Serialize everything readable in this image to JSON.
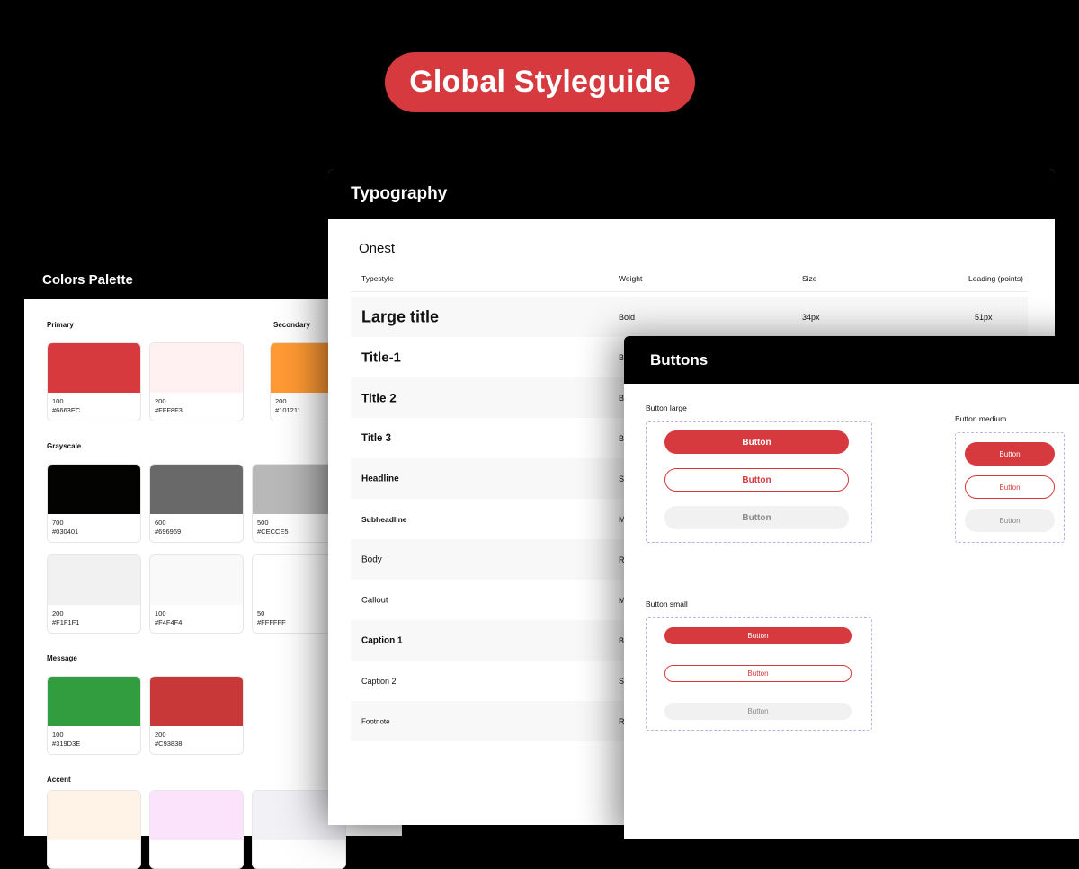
{
  "hero": {
    "title": "Global Styleguide"
  },
  "colors": {
    "title": "Colors Palette",
    "sections": [
      {
        "label": "Primary"
      },
      {
        "label": "Secondary"
      },
      {
        "label": "Grayscale"
      },
      {
        "label": "Message"
      },
      {
        "label": "Accent"
      }
    ],
    "swatches": [
      {
        "shade": "100",
        "hex": "#6663EC",
        "color": "#D63A3E"
      },
      {
        "shade": "200",
        "hex": "#FFF8F3",
        "color": "#FFF1F1"
      },
      {
        "shade": "200",
        "hex": "#101211",
        "color": "#FF9A33"
      },
      {
        "shade": "700",
        "hex": "#030401",
        "color": "#030401"
      },
      {
        "shade": "600",
        "hex": "#696969",
        "color": "#696969"
      },
      {
        "shade": "500",
        "hex": "#CECCE5",
        "color": "#B8B8B8"
      },
      {
        "shade": "200",
        "hex": "#F1F1F1",
        "color": "#F1F1F1"
      },
      {
        "shade": "100",
        "hex": "#F4F4F4",
        "color": "#F9F9F9"
      },
      {
        "shade": "50",
        "hex": "#FFFFFF",
        "color": "#FFFFFF"
      },
      {
        "shade": "100",
        "hex": "#319D3E",
        "color": "#319D3E"
      },
      {
        "shade": "200",
        "hex": "#C93838",
        "color": "#C93838"
      },
      {
        "shade": "",
        "hex": "",
        "color": "#FFF3E8"
      },
      {
        "shade": "",
        "hex": "",
        "color": "#FBE3FB"
      },
      {
        "shade": "",
        "hex": "",
        "color": "#F1F1F6"
      }
    ]
  },
  "typography": {
    "title": "Typography",
    "family": "Onest",
    "headers": {
      "typestyle": "Typestyle",
      "weight": "Weight",
      "size": "Size",
      "leading": "Leading (points)"
    },
    "rows": [
      {
        "name": "Large title",
        "weight": "Bold",
        "size": "34px",
        "leading": "51px"
      },
      {
        "name": "Title-1",
        "weight": "B",
        "size": "",
        "leading": ""
      },
      {
        "name": "Title 2",
        "weight": "B",
        "size": "",
        "leading": ""
      },
      {
        "name": "Title 3",
        "weight": "B",
        "size": "",
        "leading": ""
      },
      {
        "name": "Headline",
        "weight": "S",
        "size": "",
        "leading": ""
      },
      {
        "name": "Subheadline",
        "weight": "M",
        "size": "",
        "leading": ""
      },
      {
        "name": "Body",
        "weight": "R",
        "size": "",
        "leading": ""
      },
      {
        "name": "Callout",
        "weight": "M",
        "size": "",
        "leading": ""
      },
      {
        "name": "Caption 1",
        "weight": "B",
        "size": "",
        "leading": ""
      },
      {
        "name": "Caption 2",
        "weight": "S",
        "size": "",
        "leading": ""
      },
      {
        "name": "Footnote",
        "weight": "R",
        "size": "",
        "leading": ""
      }
    ]
  },
  "buttons": {
    "title": "Buttons",
    "large_label": "Button large",
    "medium_label": "Button medium",
    "small_label": "Button small",
    "button_text": "Button",
    "accent": "#D63A3E"
  }
}
